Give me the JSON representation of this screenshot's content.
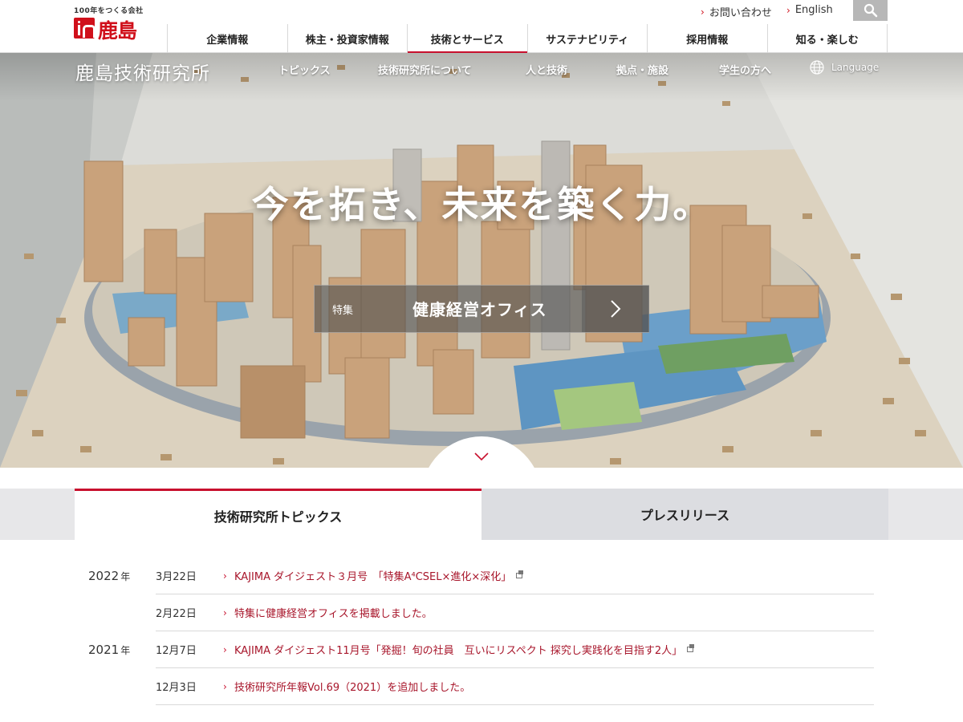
{
  "header": {
    "logo_tagline": "100年をつくる会社",
    "logo_name": "鹿島",
    "contact_link": "お問い合わせ",
    "english_link": "English",
    "nav": [
      {
        "label": "企業情報"
      },
      {
        "label": "株主・投資家情報"
      },
      {
        "label": "技術とサービス"
      },
      {
        "label": "サステナビリティ"
      },
      {
        "label": "採用情報"
      },
      {
        "label": "知る・楽しむ"
      }
    ]
  },
  "hero": {
    "site_title": "鹿島技術研究所",
    "local_nav": [
      {
        "label": "トピックス"
      },
      {
        "label": "技術研究所について"
      },
      {
        "label": "人と技術"
      },
      {
        "label": "拠点・施設"
      },
      {
        "label": "学生の方へ"
      }
    ],
    "language": "Language",
    "catchphrase": "今を拓き、未来を築く力。",
    "feature_tag": "特集",
    "feature_title": "健康経営オフィス"
  },
  "tabs": [
    {
      "label": "技術研究所トピックス",
      "active": true
    },
    {
      "label": "プレスリリース",
      "active": false
    }
  ],
  "news": [
    {
      "year": "2022",
      "year_unit": "年",
      "date": "3月22日",
      "text": "KAJIMA ダイジェスト３月号　「特集A⁴CSEL×進化×深化」",
      "external": true
    },
    {
      "year": "",
      "year_unit": "",
      "date": "2月22日",
      "text": "特集に健康経営オフィスを掲載しました。",
      "external": false
    },
    {
      "year": "2021",
      "year_unit": "年",
      "date": "12月7日",
      "text": "KAJIMA ダイジェスト11月号「発掘！旬の社員　互いにリスペクト 探究し実践化を目指す2人」",
      "external": true
    },
    {
      "year": "",
      "year_unit": "",
      "date": "12月3日",
      "text": "技術研究所年報Vol.69（2021）を追加しました。",
      "external": false
    }
  ],
  "colors": {
    "brand_red": "#d0101b",
    "accent_red": "#c8102e",
    "link": "#a8162b"
  }
}
